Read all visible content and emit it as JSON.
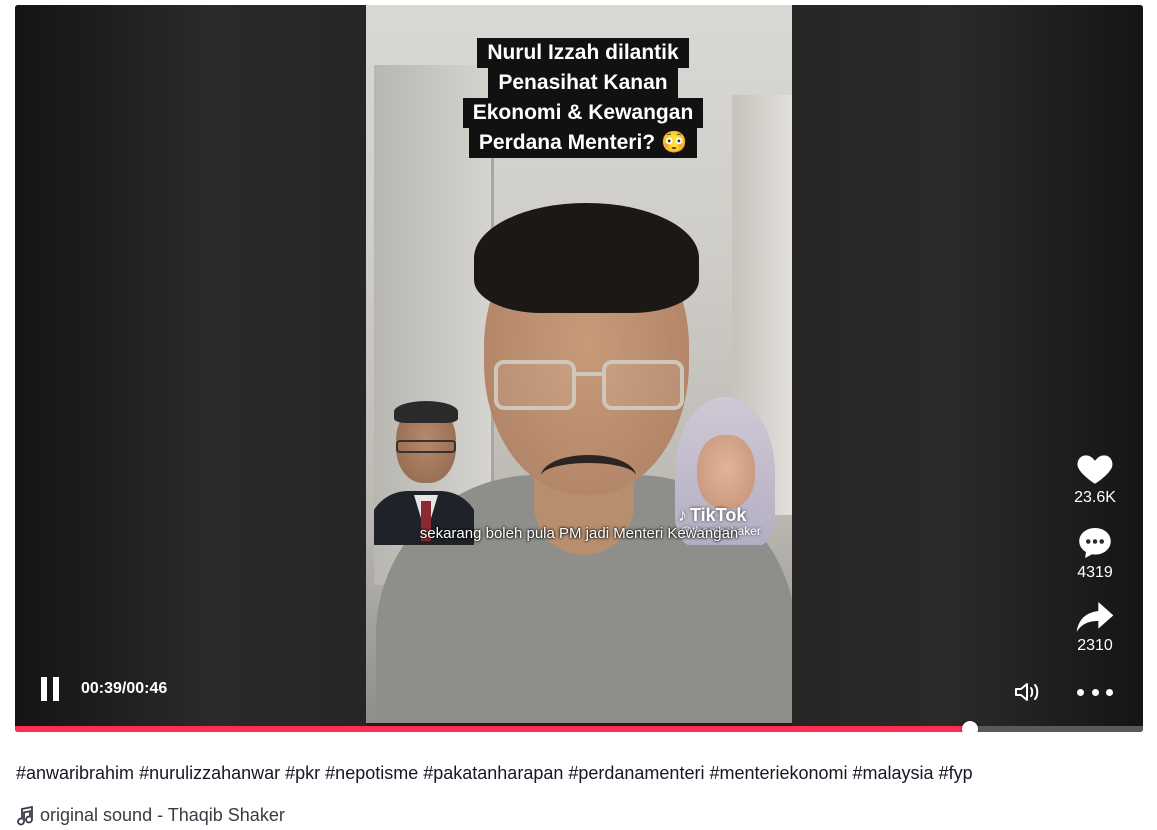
{
  "video": {
    "title_lines": [
      "Nurul Izzah dilantik",
      "Penasihat Kanan",
      "Ekonomi & Kewangan",
      "Perdana Menteri? 😳"
    ],
    "subtitle": "sekarang boleh pula PM jadi Menteri Kewangan",
    "watermark_logo": "TikTok",
    "watermark_handle": "@thaqibshaker"
  },
  "actions": {
    "likes": "23.6K",
    "comments": "4319",
    "shares": "2310"
  },
  "controls": {
    "timecode": "00:39/00:46",
    "progress": 0.847
  },
  "hashtags": [
    "#anwaribrahim",
    "#nurulizzahanwar",
    "#pkr",
    "#nepotisme",
    "#pakatanharapan",
    "#perdanamenteri",
    "#menteriekonomi",
    "#malaysia",
    "#fyp"
  ],
  "sound": "original sound - Thaqib Shaker",
  "colors": {
    "accent": "#fe2c55",
    "text": "#161823"
  }
}
